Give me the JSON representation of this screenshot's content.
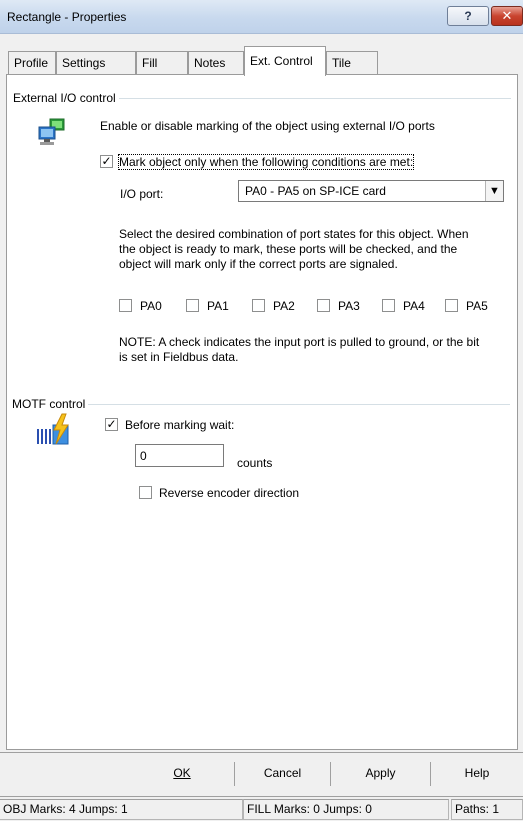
{
  "window": {
    "title": "Rectangle - Properties",
    "help_label": "?",
    "close_label": "✕"
  },
  "tabs": [
    {
      "label": "Profile"
    },
    {
      "label": "Settings"
    },
    {
      "label": "Fill"
    },
    {
      "label": "Notes"
    },
    {
      "label": "Ext. Control",
      "active": true
    },
    {
      "label": "Tile"
    }
  ],
  "ext_io": {
    "group_title": "External I/O control",
    "description": "Enable or disable marking of the object using external I/O ports",
    "mark_only_label": "Mark object only when the following conditions are met:",
    "mark_only_checked": true,
    "io_port_label": "I/O port:",
    "io_port_value": "PA0 - PA5 on SP-ICE card",
    "instructions": [
      "Select the desired combination of port states for this object. When",
      "the object is ready to mark, these ports will be checked, and the",
      "object will mark only if the correct ports are signaled."
    ],
    "ports": [
      {
        "label": "PA0",
        "checked": false
      },
      {
        "label": "PA1",
        "checked": false
      },
      {
        "label": "PA2",
        "checked": false
      },
      {
        "label": "PA3",
        "checked": false
      },
      {
        "label": "PA4",
        "checked": false
      },
      {
        "label": "PA5",
        "checked": false
      }
    ],
    "note": [
      "NOTE: A check indicates the input port is pulled to ground, or the bit",
      "is set in Fieldbus data."
    ]
  },
  "motf": {
    "group_title": "MOTF control",
    "before_wait_label": "Before marking wait:",
    "before_wait_checked": true,
    "counts_value": "0",
    "counts_label": "counts",
    "reverse_label": "Reverse encoder direction",
    "reverse_checked": false
  },
  "buttons": {
    "ok": "OK",
    "cancel": "Cancel",
    "apply": "Apply",
    "help": "Help"
  },
  "status": {
    "obj": "OBJ  Marks: 4  Jumps: 1",
    "fill": "FILL  Marks: 0  Jumps: 0",
    "paths": "Paths: 1"
  },
  "colors": {
    "titlebar": "#c8d9ee",
    "close_button": "#c9442f",
    "group_line": "#d5dfe5",
    "panel_bg": "#ffffff",
    "dialog_bg": "#f0f0f0"
  }
}
